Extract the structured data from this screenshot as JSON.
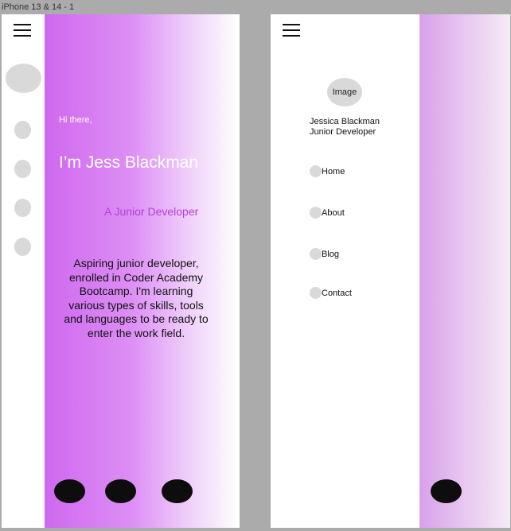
{
  "frame_title": "iPhone 13 & 14 - 1",
  "hero": {
    "greeting": "Hi there,",
    "name": "I’m Jess Blackman",
    "role": "A Junior Developer",
    "bio": "Aspiring junior developer, enrolled in Coder Academy Bootcamp. I'm learning various types of skills, tools and languages to be ready to enter the work field."
  },
  "menu_panel": {
    "image_label": "Image",
    "profile_name": "Jessica Blackman",
    "profile_title": "Junior Developer",
    "items": [
      {
        "label": "Home"
      },
      {
        "label": "About"
      },
      {
        "label": "Blog"
      },
      {
        "label": "Contact"
      }
    ]
  },
  "icons": {
    "menu": "hamburger-icon",
    "avatar": "avatar-placeholder",
    "social": "social-icon"
  },
  "colors": {
    "gradient_start": "#cf68ef",
    "accent_text": "#b63ddb",
    "placeholder_gray": "#d9d9d9",
    "social_black": "#0d0d0d",
    "canvas_gray": "#ababab"
  }
}
